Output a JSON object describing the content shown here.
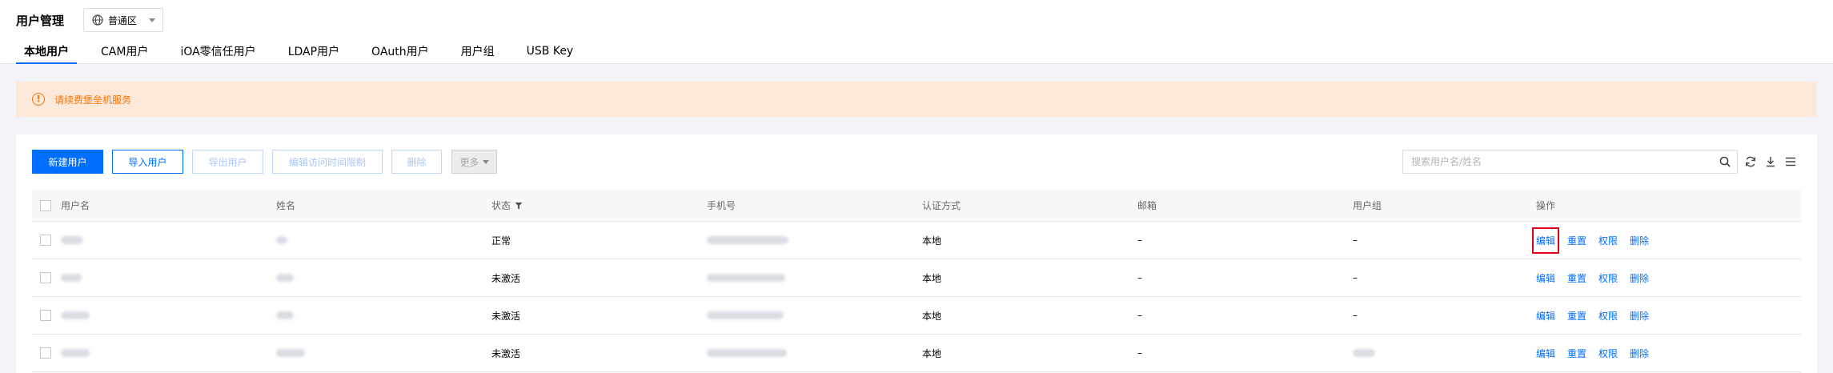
{
  "header": {
    "title": "用户管理",
    "region": "普通区"
  },
  "tabs": [
    {
      "label": "本地用户",
      "active": true
    },
    {
      "label": "CAM用户",
      "active": false
    },
    {
      "label": "iOA零信任用户",
      "active": false
    },
    {
      "label": "LDAP用户",
      "active": false
    },
    {
      "label": "OAuth用户",
      "active": false
    },
    {
      "label": "用户组",
      "active": false
    },
    {
      "label": "USB Key",
      "active": false
    }
  ],
  "alert": {
    "text": "请续费堡垒机服务",
    "icon": "warning-icon",
    "color": "#ff7200"
  },
  "toolbar": {
    "new_user": "新建用户",
    "import_users": "导入用户",
    "export_users": "导出用户",
    "edit_access_time": "编辑访问时间限制",
    "delete": "删除",
    "more": "更多"
  },
  "search": {
    "placeholder": "搜索用户名/姓名"
  },
  "table": {
    "columns": {
      "username": "用户名",
      "name": "姓名",
      "status": "状态",
      "phone": "手机号",
      "auth": "认证方式",
      "email": "邮箱",
      "group": "用户组",
      "ops": "操作"
    },
    "rows": [
      {
        "status": "正常",
        "auth": "本地",
        "email": "–",
        "group": "–"
      },
      {
        "status": "未激活",
        "auth": "本地",
        "email": "–",
        "group": "–"
      },
      {
        "status": "未激活",
        "auth": "本地",
        "email": "–",
        "group": "–"
      },
      {
        "status": "未激活",
        "auth": "本地",
        "email": "–",
        "group": ""
      }
    ],
    "actions": {
      "edit": "编辑",
      "reset": "重置",
      "permissions": "权限",
      "delete": "删除"
    }
  },
  "colors": {
    "accent": "#006eff",
    "alert_bg": "#fde9da",
    "highlight": "#e6001a"
  }
}
